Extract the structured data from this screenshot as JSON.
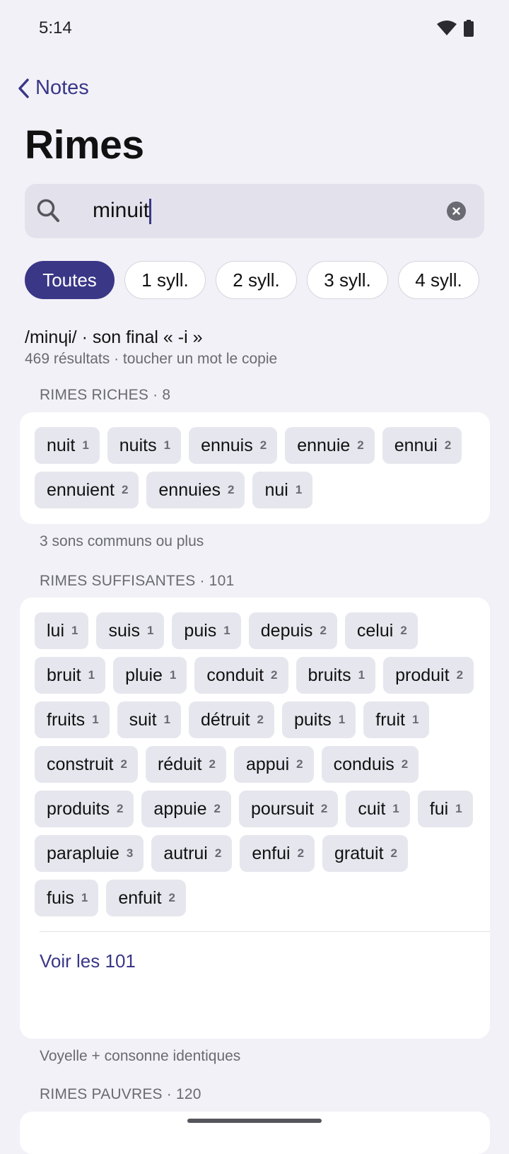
{
  "status": {
    "time": "5:14"
  },
  "nav": {
    "back_label": "Notes"
  },
  "title": "Rimes",
  "search": {
    "value": "minuit"
  },
  "filters": [
    {
      "label": "Toutes",
      "active": true
    },
    {
      "label": "1 syll.",
      "active": false
    },
    {
      "label": "2 syll.",
      "active": false
    },
    {
      "label": "3 syll.",
      "active": false
    },
    {
      "label": "4 syll.",
      "active": false
    }
  ],
  "info": {
    "phonetic": "/minɥi/ · son final « -i »",
    "count": "469 résultats · toucher un mot le copie"
  },
  "sections": [
    {
      "header": "RIMES RICHES · 8",
      "words": [
        {
          "w": "nuit",
          "s": "1"
        },
        {
          "w": "nuits",
          "s": "1"
        },
        {
          "w": "ennuis",
          "s": "2"
        },
        {
          "w": "ennuie",
          "s": "2"
        },
        {
          "w": "ennui",
          "s": "2"
        },
        {
          "w": "ennuient",
          "s": "2"
        },
        {
          "w": "ennuies",
          "s": "2"
        },
        {
          "w": "nui",
          "s": "1"
        }
      ],
      "footnote": "3 sons communs ou plus"
    },
    {
      "header": "RIMES SUFFISANTES · 101",
      "words": [
        {
          "w": "lui",
          "s": "1"
        },
        {
          "w": "suis",
          "s": "1"
        },
        {
          "w": "puis",
          "s": "1"
        },
        {
          "w": "depuis",
          "s": "2"
        },
        {
          "w": "celui",
          "s": "2"
        },
        {
          "w": "bruit",
          "s": "1"
        },
        {
          "w": "pluie",
          "s": "1"
        },
        {
          "w": "conduit",
          "s": "2"
        },
        {
          "w": "bruits",
          "s": "1"
        },
        {
          "w": "produit",
          "s": "2"
        },
        {
          "w": "fruits",
          "s": "1"
        },
        {
          "w": "suit",
          "s": "1"
        },
        {
          "w": "détruit",
          "s": "2"
        },
        {
          "w": "puits",
          "s": "1"
        },
        {
          "w": "fruit",
          "s": "1"
        },
        {
          "w": "construit",
          "s": "2"
        },
        {
          "w": "réduit",
          "s": "2"
        },
        {
          "w": "appui",
          "s": "2"
        },
        {
          "w": "conduis",
          "s": "2"
        },
        {
          "w": "produits",
          "s": "2"
        },
        {
          "w": "appuie",
          "s": "2"
        },
        {
          "w": "poursuit",
          "s": "2"
        },
        {
          "w": "cuit",
          "s": "1"
        },
        {
          "w": "fui",
          "s": "1"
        },
        {
          "w": "parapluie",
          "s": "3"
        },
        {
          "w": "autrui",
          "s": "2"
        },
        {
          "w": "enfui",
          "s": "2"
        },
        {
          "w": "gratuit",
          "s": "2"
        },
        {
          "w": "fuis",
          "s": "1"
        },
        {
          "w": "enfuit",
          "s": "2"
        }
      ],
      "see_all": "Voir les 101",
      "footnote": "Voyelle + consonne identiques"
    },
    {
      "header": "RIMES PAUVRES · 120"
    }
  ],
  "colors": {
    "accent": "#3A3787",
    "background": "#F2F1F7",
    "chip": "#E6E6EE"
  }
}
